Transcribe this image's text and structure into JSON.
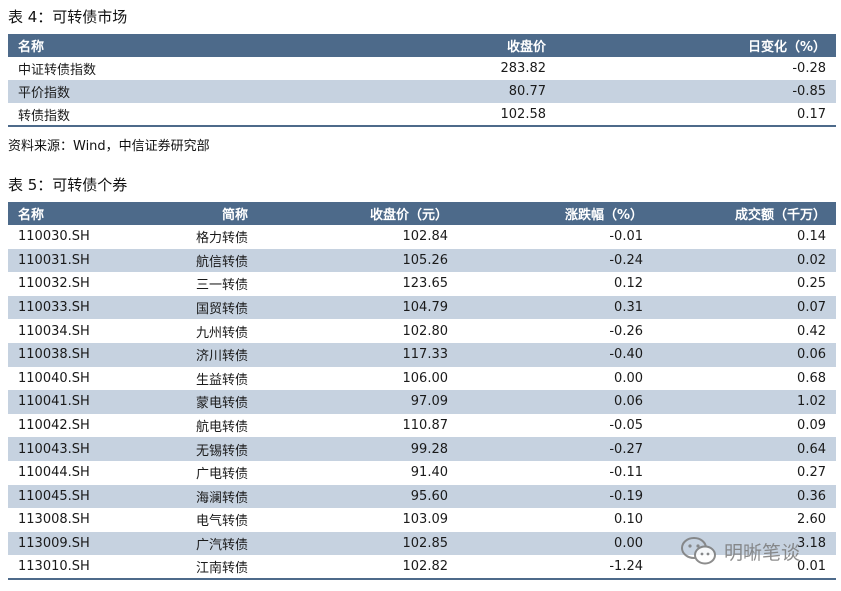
{
  "table4": {
    "caption": "表 4：可转债市场",
    "headers": [
      "名称",
      "收盘价",
      "日变化（%）"
    ],
    "rows": [
      [
        "中证转债指数",
        "283.82",
        "-0.28"
      ],
      [
        "平价指数",
        "80.77",
        "-0.85"
      ],
      [
        "转债指数",
        "102.58",
        "0.17"
      ]
    ],
    "source": "资料来源：Wind，中信证券研究部"
  },
  "table5": {
    "caption": "表 5：可转债个券",
    "headers": [
      "名称",
      "简称",
      "收盘价（元）",
      "涨跌幅（%）",
      "成交额（千万）"
    ],
    "rows": [
      [
        "110030.SH",
        "格力转债",
        "102.84",
        "-0.01",
        "0.14"
      ],
      [
        "110031.SH",
        "航信转债",
        "105.26",
        "-0.24",
        "0.02"
      ],
      [
        "110032.SH",
        "三一转债",
        "123.65",
        "0.12",
        "0.25"
      ],
      [
        "110033.SH",
        "国贸转债",
        "104.79",
        "0.31",
        "0.07"
      ],
      [
        "110034.SH",
        "九州转债",
        "102.80",
        "-0.26",
        "0.42"
      ],
      [
        "110038.SH",
        "济川转债",
        "117.33",
        "-0.40",
        "0.06"
      ],
      [
        "110040.SH",
        "生益转债",
        "106.00",
        "0.00",
        "0.68"
      ],
      [
        "110041.SH",
        "蒙电转债",
        "97.09",
        "0.06",
        "1.02"
      ],
      [
        "110042.SH",
        "航电转债",
        "110.87",
        "-0.05",
        "0.09"
      ],
      [
        "110043.SH",
        "无锡转债",
        "99.28",
        "-0.27",
        "0.64"
      ],
      [
        "110044.SH",
        "广电转债",
        "91.40",
        "-0.11",
        "0.27"
      ],
      [
        "110045.SH",
        "海澜转债",
        "95.60",
        "-0.19",
        "0.36"
      ],
      [
        "113008.SH",
        "电气转债",
        "103.09",
        "0.10",
        "2.60"
      ],
      [
        "113009.SH",
        "广汽转债",
        "102.85",
        "0.00",
        "3.18"
      ],
      [
        "113010.SH",
        "江南转债",
        "102.82",
        "-1.24",
        "0.01"
      ]
    ]
  },
  "watermark": {
    "text": "明晰笔谈",
    "icon": "wechat-icon"
  },
  "colors": {
    "header_bg": "#4d6a8a",
    "alt_row_bg": "#c6d2e0",
    "header_text": "#ffffff"
  }
}
